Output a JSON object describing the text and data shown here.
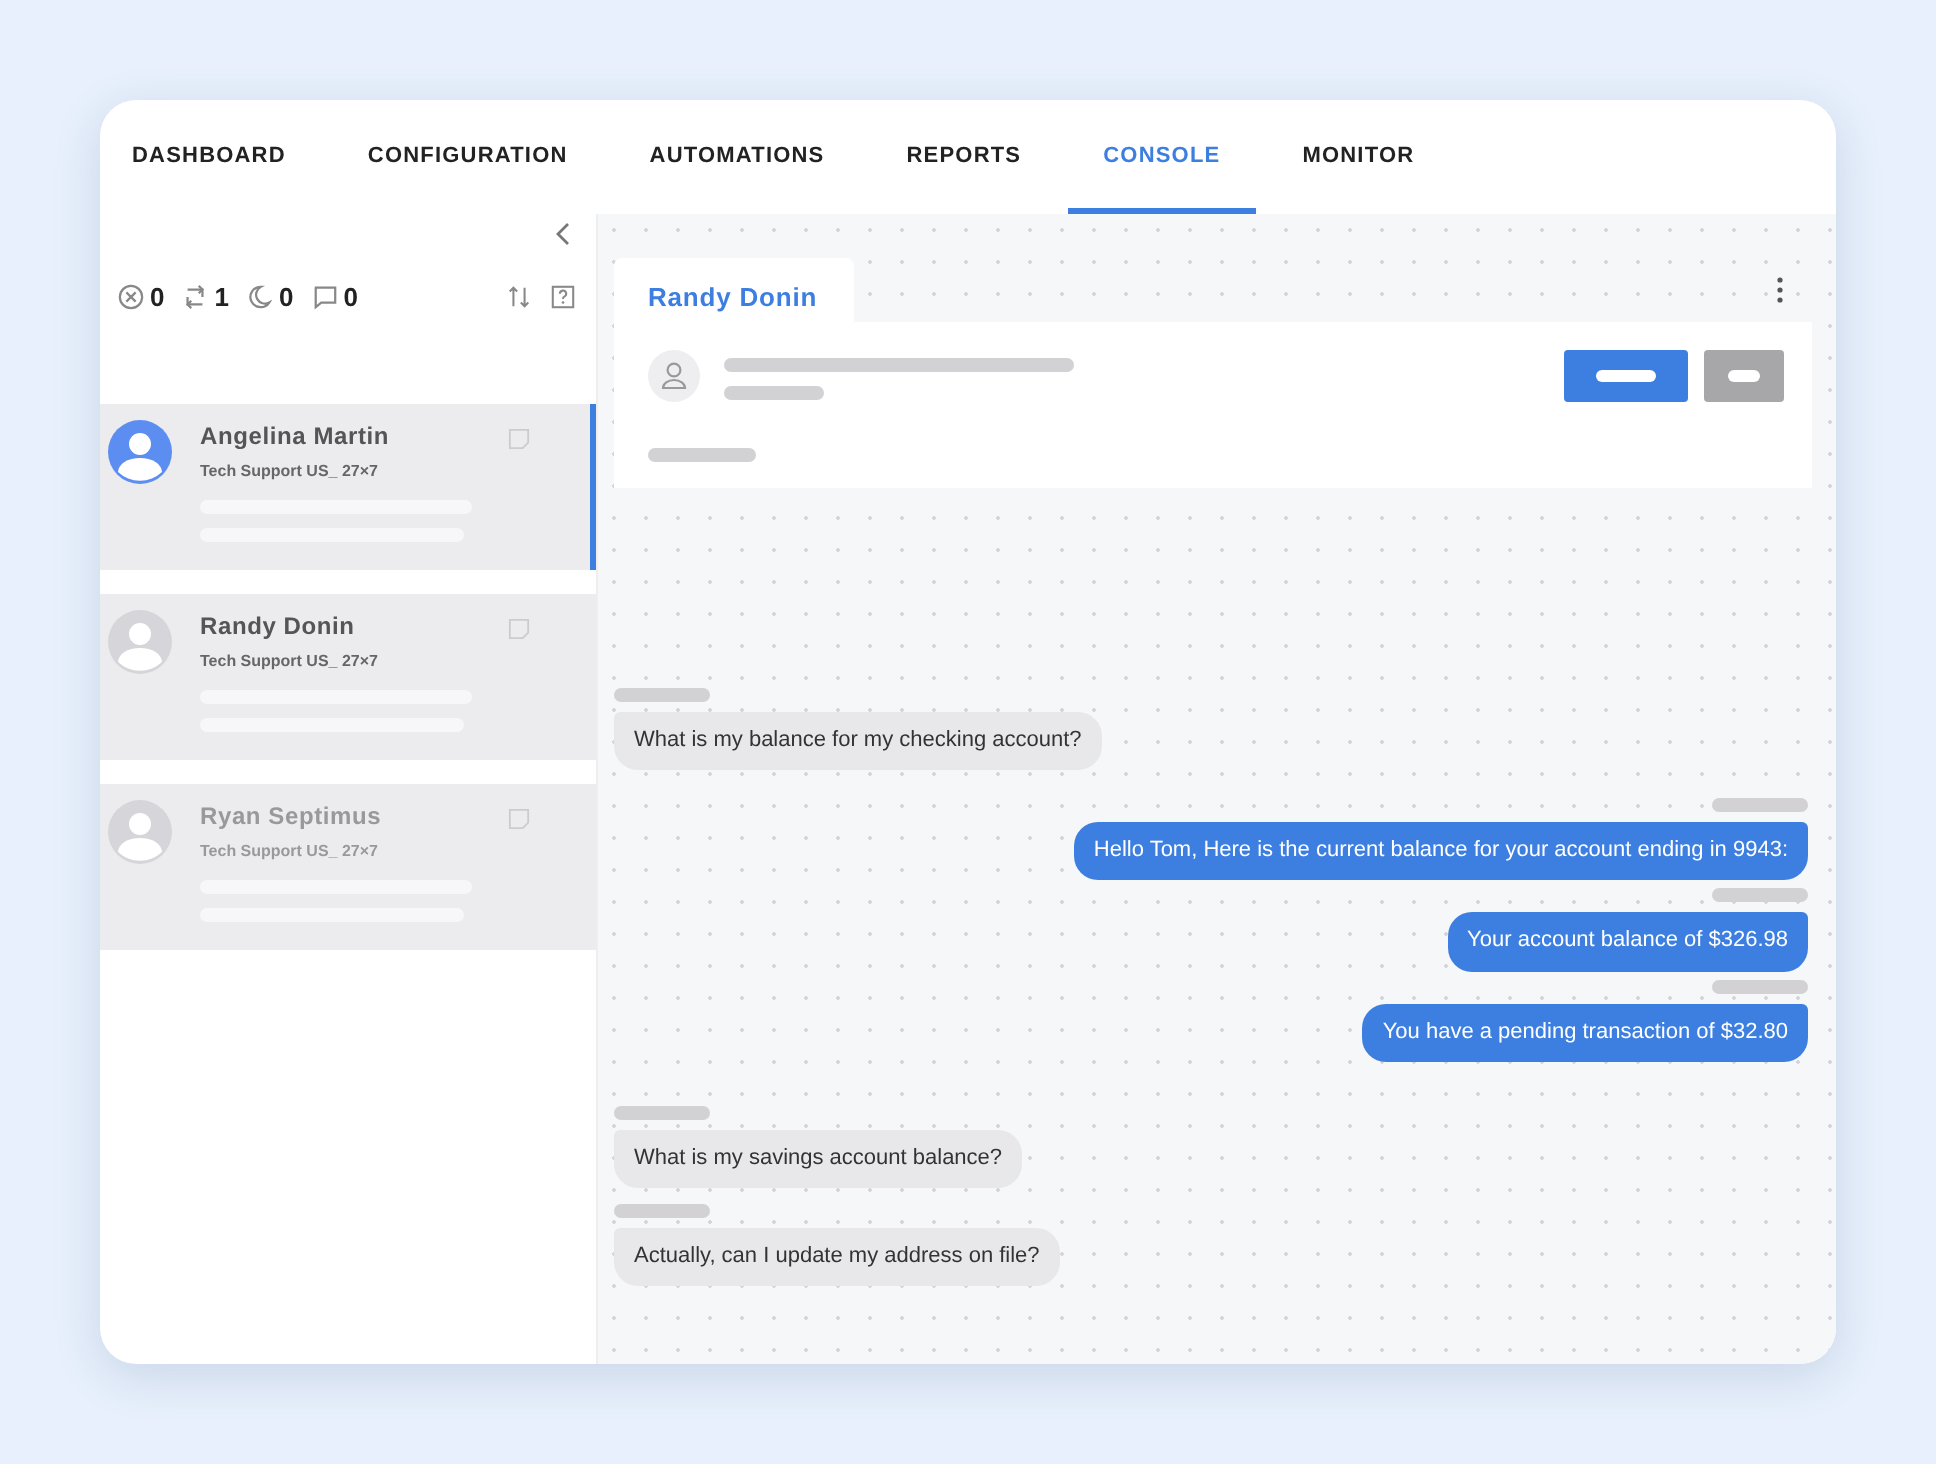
{
  "tabs": [
    {
      "label": "DASHBOARD",
      "selected": false
    },
    {
      "label": "CONFIGURATION",
      "selected": false
    },
    {
      "label": "AUTOMATIONS",
      "selected": false
    },
    {
      "label": "REPORTS",
      "selected": false
    },
    {
      "label": "CONSOLE",
      "selected": true
    },
    {
      "label": "MONITOR",
      "selected": false
    }
  ],
  "counters": [
    {
      "kind": "closed",
      "count": "0"
    },
    {
      "kind": "transfer",
      "count": "1"
    },
    {
      "kind": "away",
      "count": "0"
    },
    {
      "kind": "chat",
      "count": "0"
    }
  ],
  "conversations": [
    {
      "name": "Angelina Martin",
      "queue": "Tech Support US_ 27×7",
      "selected": true,
      "disabled": false
    },
    {
      "name": "Randy Donin",
      "queue": "Tech Support US_ 27×7",
      "selected": false,
      "disabled": false
    },
    {
      "name": "Ryan Septimus",
      "queue": "Tech Support US_ 27×7",
      "selected": false,
      "disabled": true
    }
  ],
  "chat": {
    "contact_tab": "Randy Donin",
    "messages": [
      {
        "kind": "incoming",
        "text": "What is my balance for my checking account?"
      },
      {
        "kind": "outgoing",
        "text": "Hello Tom, Here is the current balance for your account ending in 9943:"
      },
      {
        "kind": "outgoing",
        "text": "Your account balance of $326.98"
      },
      {
        "kind": "outgoing",
        "text": "You have a pending transaction of $32.80"
      },
      {
        "kind": "incoming",
        "text": "What is my savings account balance?"
      },
      {
        "kind": "incoming",
        "text": "Actually, can I update my address on file?"
      }
    ]
  }
}
